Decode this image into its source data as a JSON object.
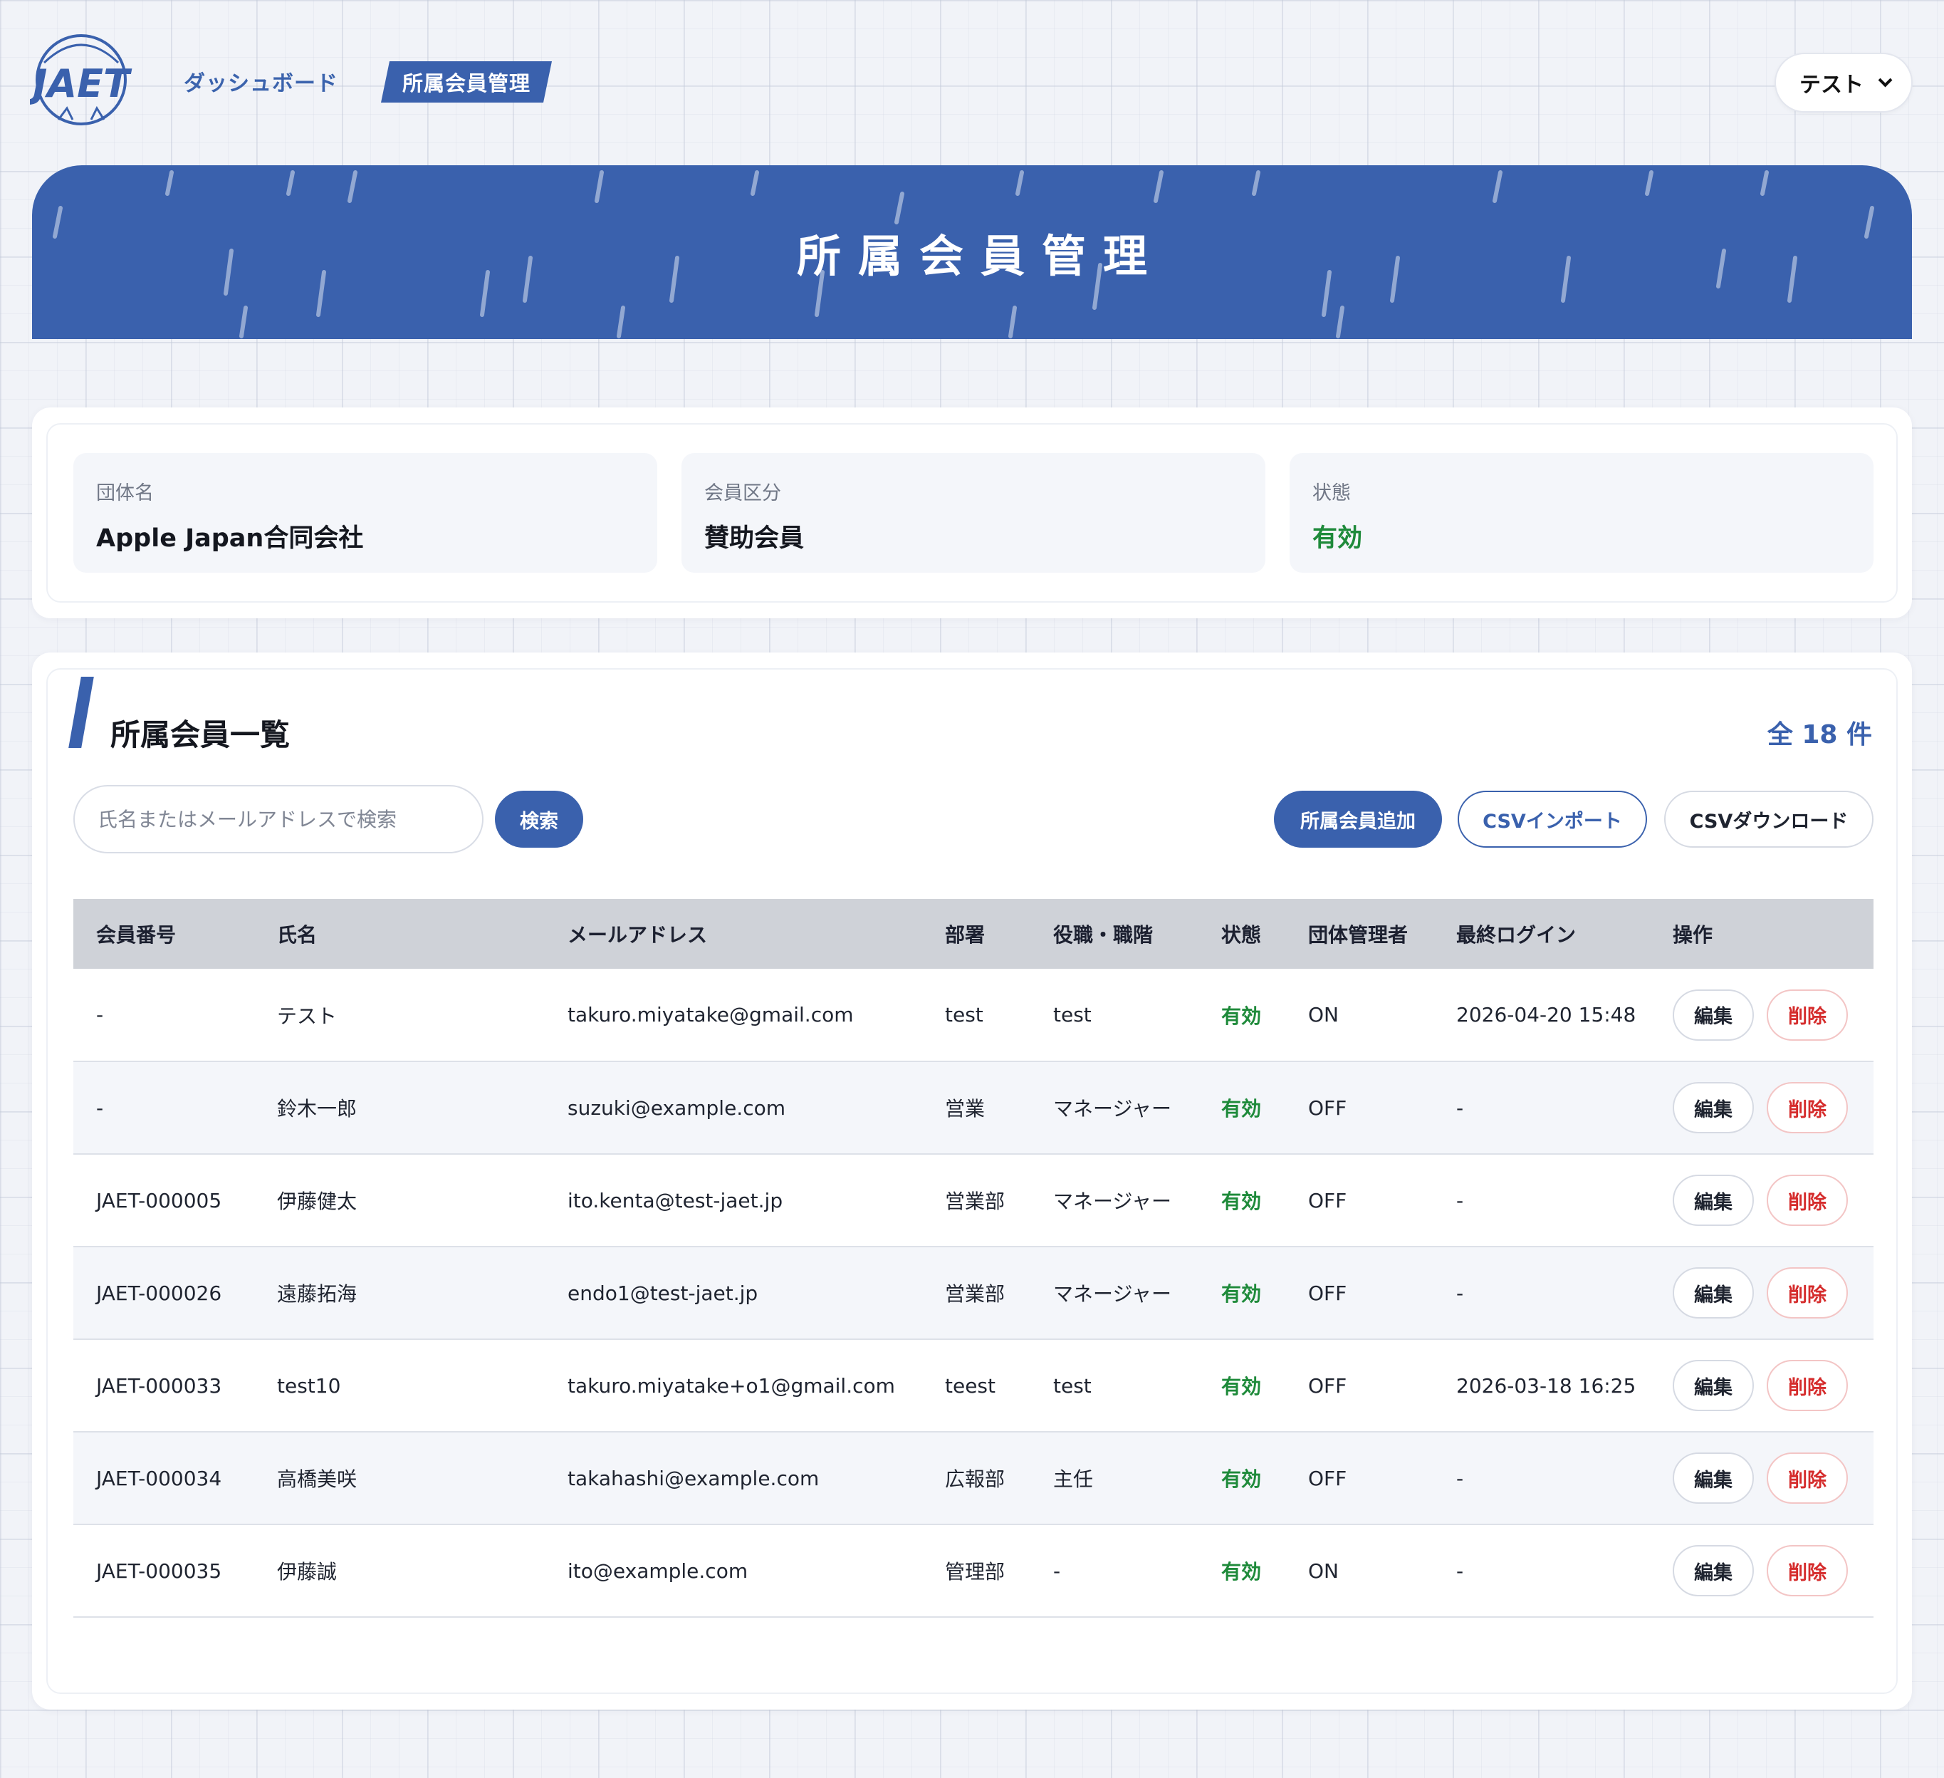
{
  "nav": {
    "logo_text": "JAET",
    "dashboard": "ダッシュボード",
    "active": "所属会員管理",
    "user": "テスト"
  },
  "banner": {
    "title": "所属会員管理"
  },
  "org": {
    "name_label": "団体名",
    "name_value": "Apple Japan合同会社",
    "type_label": "会員区分",
    "type_value": "賛助会員",
    "status_label": "状態",
    "status_value": "有効"
  },
  "members": {
    "title": "所属会員一覧",
    "total": "全 18 件",
    "search_placeholder": "氏名またはメールアドレスで検索",
    "search_btn": "検索",
    "add_btn": "所属会員追加",
    "import_btn": "CSVインポート",
    "download_btn": "CSVダウンロード",
    "columns": [
      "会員番号",
      "氏名",
      "メールアドレス",
      "部署",
      "役職・職階",
      "状態",
      "団体管理者",
      "最終ログイン",
      "操作"
    ],
    "edit_label": "編集",
    "delete_label": "削除",
    "rows": [
      {
        "id": "-",
        "name": "テスト",
        "email": "takuro.miyatake@gmail.com",
        "dept": "test",
        "position": "test",
        "status": "有効",
        "admin": "ON",
        "last_login": "2026-04-20 15:48"
      },
      {
        "id": "-",
        "name": "鈴木一郎",
        "email": "suzuki@example.com",
        "dept": "営業",
        "position": "マネージャー",
        "status": "有効",
        "admin": "OFF",
        "last_login": "-"
      },
      {
        "id": "JAET-000005",
        "name": "伊藤健太",
        "email": "ito.kenta@test-jaet.jp",
        "dept": "営業部",
        "position": "マネージャー",
        "status": "有効",
        "admin": "OFF",
        "last_login": "-"
      },
      {
        "id": "JAET-000026",
        "name": "遠藤拓海",
        "email": "endo1@test-jaet.jp",
        "dept": "営業部",
        "position": "マネージャー",
        "status": "有効",
        "admin": "OFF",
        "last_login": "-"
      },
      {
        "id": "JAET-000033",
        "name": "test10",
        "email": "takuro.miyatake+o1@gmail.com",
        "dept": "teest",
        "position": "test",
        "status": "有効",
        "admin": "OFF",
        "last_login": "2026-03-18 16:25"
      },
      {
        "id": "JAET-000034",
        "name": "高橋美咲",
        "email": "takahashi@example.com",
        "dept": "広報部",
        "position": "主任",
        "status": "有効",
        "admin": "OFF",
        "last_login": "-"
      },
      {
        "id": "JAET-000035",
        "name": "伊藤誠",
        "email": "ito@example.com",
        "dept": "管理部",
        "position": "-",
        "status": "有効",
        "admin": "ON",
        "last_login": "-"
      }
    ]
  },
  "colors": {
    "primary": "#3a61ad",
    "green": "#1e8a3a",
    "red": "#d52c2c"
  }
}
